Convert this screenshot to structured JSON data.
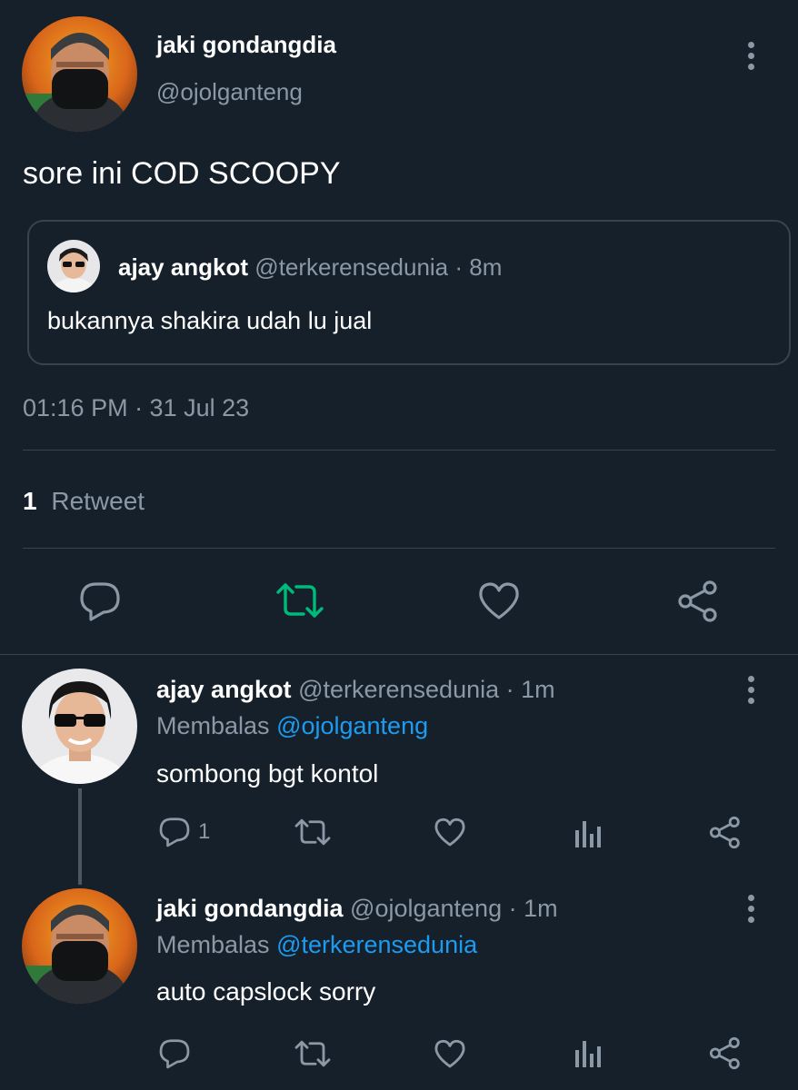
{
  "main_tweet": {
    "author_name": "jaki gondangdia",
    "author_handle": "@ojolganteng",
    "text": "sore ini COD SCOOPY",
    "quoted": {
      "author_name": "ajay angkot",
      "author_handle": "@terkerensedunia",
      "time": "· 8m",
      "text": "bukannya shakira udah lu jual"
    },
    "timestamp": "01:16 PM · 31 Jul 23",
    "retweet_count": "1",
    "retweet_label": "Retweet"
  },
  "replies": [
    {
      "author_name": "ajay angkot",
      "author_handle": "@terkerensedunia",
      "time": "· 1m",
      "replying_label": "Membalas",
      "replying_to": "@ojolganteng",
      "text": "sombong bgt kontol",
      "reply_count": "1"
    },
    {
      "author_name": "jaki gondangdia",
      "author_handle": "@ojolganteng",
      "time": "· 1m",
      "replying_label": "Membalas",
      "replying_to": "@terkerensedunia",
      "text": "auto capslock sorry",
      "reply_count": ""
    }
  ],
  "colors": {
    "background": "#15202b",
    "muted": "#8b98a5",
    "link": "#1d9bf0",
    "retweet_active": "#00ba7c",
    "divider": "#38444d"
  },
  "icons": [
    "reply-icon",
    "retweet-icon",
    "like-icon",
    "share-icon",
    "views-icon",
    "more-options-icon"
  ]
}
